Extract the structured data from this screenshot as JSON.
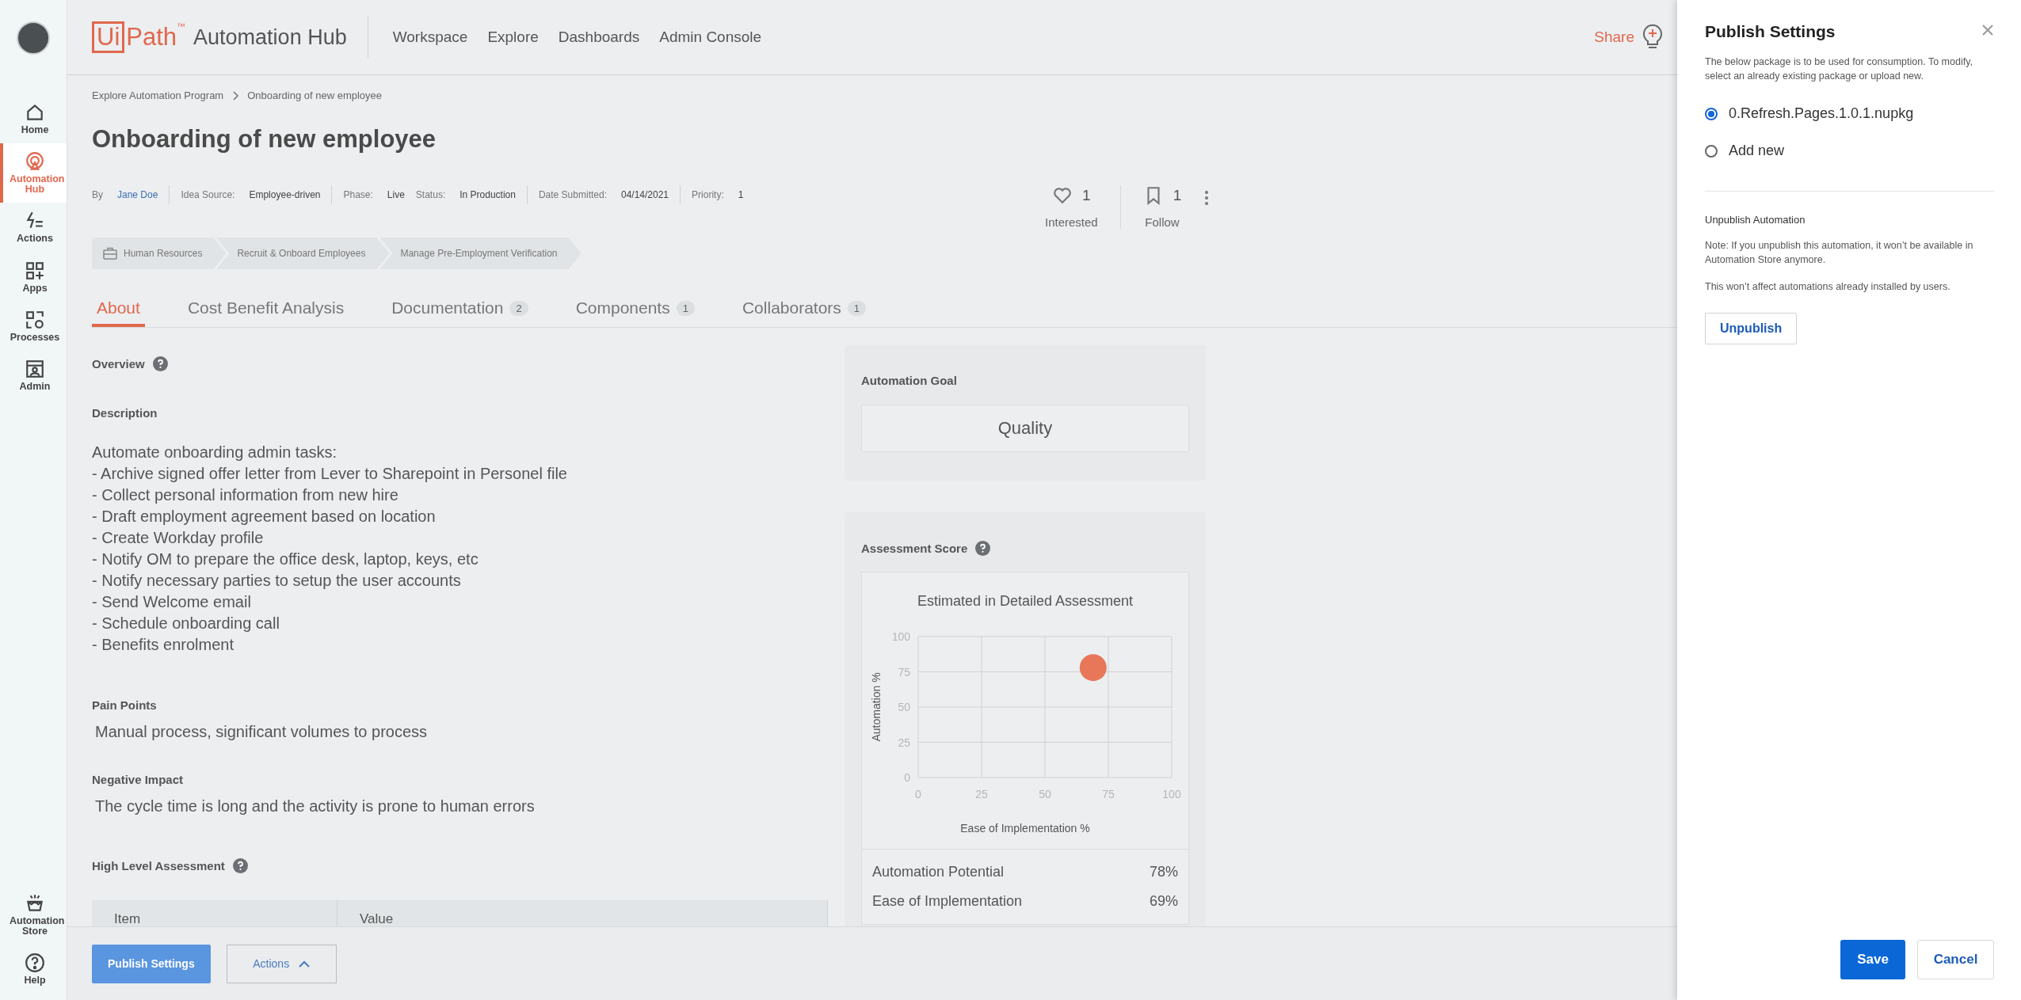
{
  "sidebar": {
    "items": [
      {
        "label": "Home",
        "selected": false
      },
      {
        "label": "Automation Hub",
        "selected": true
      },
      {
        "label": "Actions",
        "selected": false
      },
      {
        "label": "Apps",
        "selected": false
      },
      {
        "label": "Processes",
        "selected": false
      },
      {
        "label": "Admin",
        "selected": false
      }
    ],
    "bottom_items": [
      {
        "label": "Automation Store",
        "selected": false
      },
      {
        "label": "Help",
        "selected": false
      }
    ]
  },
  "header": {
    "logo": {
      "boxed": "Ui",
      "rest": "Path",
      "mark": "™"
    },
    "app_name": "Automation Hub",
    "nav": [
      "Workspace",
      "Explore",
      "Dashboards",
      "Admin Console"
    ],
    "share": "Share"
  },
  "breadcrumb": [
    "Explore Automation Program",
    "Onboarding of new employee"
  ],
  "title": "Onboarding of new employee",
  "meta": [
    [
      {
        "label": "By",
        "value": "Jane Doe",
        "kind": "link"
      }
    ],
    [
      {
        "label": "Idea Source:",
        "value": "Employee-driven",
        "kind": "text"
      }
    ],
    [
      {
        "label": "Phase:",
        "value": "Live",
        "kind": "text"
      },
      {
        "label": "Status:",
        "value": "In Production",
        "kind": "text"
      }
    ],
    [
      {
        "label": "Date Submitted:",
        "value": "04/14/2021",
        "kind": "text"
      }
    ],
    [
      {
        "label": "Priority:",
        "value": "1",
        "kind": "text"
      }
    ]
  ],
  "stats": [
    {
      "count": "1",
      "label": "Interested"
    },
    {
      "count": "1",
      "label": "Follow"
    }
  ],
  "categories": [
    "Human Resources",
    "Recruit & Onboard Employees",
    "Manage Pre-Employment Verification"
  ],
  "tabs": [
    {
      "label": "About",
      "selected": true
    },
    {
      "label": "Cost Benefit Analysis",
      "selected": false
    },
    {
      "label": "Documentation",
      "count": "2",
      "selected": false
    },
    {
      "label": "Components",
      "count": "1",
      "selected": false
    },
    {
      "label": "Collaborators",
      "count": "1",
      "selected": false
    }
  ],
  "about": {
    "overview": "Overview",
    "description_heading": "Description",
    "description": [
      "Automate onboarding admin tasks:",
      "- Archive signed offer letter from Lever to Sharepoint in Personel file",
      "- Collect personal information from new hire",
      "- Draft employment agreement based on location",
      "- Create Workday profile",
      "- Notify OM to prepare the office desk, laptop, keys, etc",
      "- Notify necessary parties to setup the user accounts",
      "- Send Welcome email",
      "- Schedule onboarding call",
      "- Benefits enrolment"
    ],
    "pain_points_heading": "Pain Points",
    "pain_points": "Manual process, significant volumes to process",
    "negative_impact_heading": "Negative Impact",
    "negative_impact": "The cycle time is long and the activity is prone to human errors",
    "assessment_heading": "High Level Assessment",
    "table": {
      "columns": [
        "Item",
        "Value"
      ]
    }
  },
  "goal": {
    "heading": "Automation Goal",
    "value": "Quality"
  },
  "score": {
    "heading": "Assessment Score",
    "chart_data": {
      "type": "scatter",
      "title": "Estimated in Detailed Assessment",
      "xlabel": "Ease of Implementation %",
      "ylabel": "Automation %",
      "x": [
        69
      ],
      "series": [
        {
          "color": "#e8775a",
          "values": [
            78
          ]
        }
      ],
      "grid": true,
      "xlim": [
        0,
        100
      ],
      "ylim": [
        0,
        100
      ],
      "xticks": [
        0,
        25,
        50,
        75,
        100
      ],
      "yticks": [
        0,
        25,
        50,
        75,
        100
      ]
    },
    "rows": [
      {
        "label": "Automation Potential",
        "value": "78%"
      },
      {
        "label": "Ease of Implementation",
        "value": "69%"
      }
    ]
  },
  "footer": {
    "publish_button": "Publish Settings",
    "actions_button": "Actions"
  },
  "panel": {
    "title": "Publish Settings",
    "description": "The below package is to be used for consumption. To modify, select an already existing package or upload new.",
    "options": [
      {
        "label": "0.Refresh.Pages.1.0.1.nupkg",
        "selected": true
      },
      {
        "label": "Add new",
        "selected": false
      }
    ],
    "unpublish_heading": "Unpublish Automation",
    "notes": [
      "Note: If you unpublish this automation, it won’t be available in Automation Store anymore.",
      "This won’t affect automations already installed by users."
    ],
    "unpublish_button": "Unpublish",
    "save_button": "Save",
    "cancel_button": "Cancel"
  }
}
